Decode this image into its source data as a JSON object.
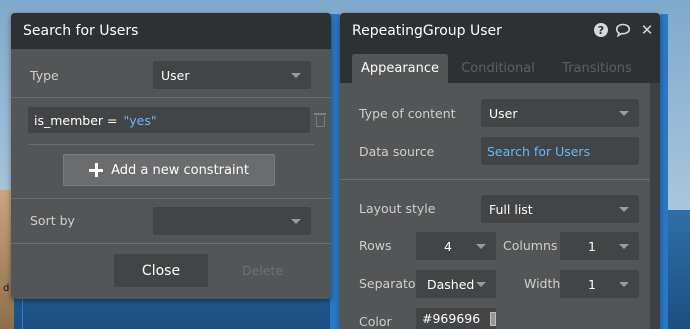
{
  "background": {
    "edge_text": "d"
  },
  "search_panel": {
    "title": "Search for Users",
    "type_label": "Type",
    "type_value": "User",
    "constraint_field": "is_member =",
    "constraint_value": "\"yes\"",
    "add_constraint_label": "Add a new constraint",
    "sort_by_label": "Sort by",
    "sort_by_value": "",
    "close_label": "Close",
    "delete_label": "Delete"
  },
  "rg_panel": {
    "title": "RepeatingGroup User",
    "tabs": [
      {
        "label": "Appearance"
      },
      {
        "label": "Conditional"
      },
      {
        "label": "Transitions"
      }
    ],
    "type_of_content_label": "Type of content",
    "type_of_content_value": "User",
    "data_source_label": "Data source",
    "data_source_value": "Search for Users",
    "layout_style_label": "Layout style",
    "layout_style_value": "Full list",
    "rows_label": "Rows",
    "rows_value": "4",
    "columns_label": "Columns",
    "columns_value": "1",
    "separator_label": "Separator",
    "separator_value": "Dashed",
    "width_label": "Width",
    "width_value": "1",
    "color_label": "Color",
    "color_value": "#969696",
    "icons": [
      "help-icon",
      "comment-icon",
      "close-icon"
    ]
  },
  "colors": {
    "accent": "#69b6ff",
    "panel": "#535557",
    "header": "#2e3133",
    "swatch": "#969696"
  }
}
